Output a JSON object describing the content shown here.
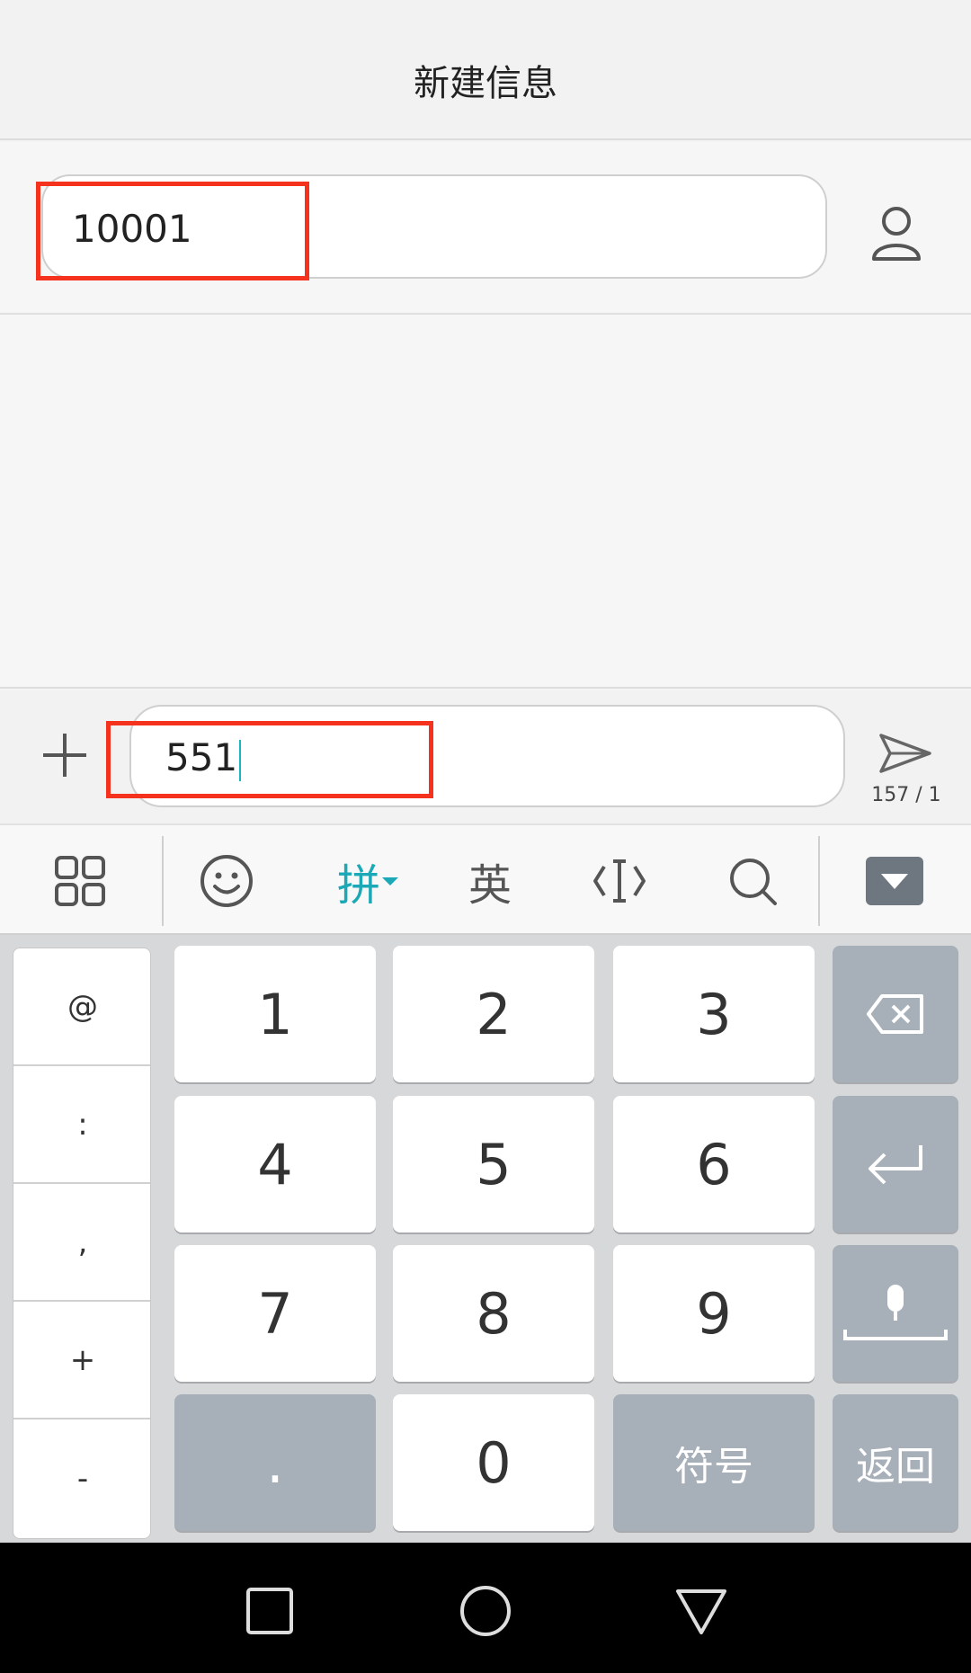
{
  "header": {
    "title": "新建信息"
  },
  "recipient": {
    "value": "10001"
  },
  "compose": {
    "value": "551",
    "counter": "157 / 1"
  },
  "toolbar": {
    "pinyin_label": "拼",
    "english_label": "英"
  },
  "keyboard": {
    "side_keys": [
      "@",
      ":",
      ",",
      "+",
      "-"
    ],
    "digits": [
      "1",
      "2",
      "3",
      "4",
      "5",
      "6",
      "7",
      "8",
      "9",
      "0"
    ],
    "dot": ".",
    "symbols_label": "符号",
    "back_label": "返回"
  },
  "colors": {
    "highlight": "#f5321e",
    "accent": "#1ba9b7",
    "gray_key": "#a7afb9"
  }
}
